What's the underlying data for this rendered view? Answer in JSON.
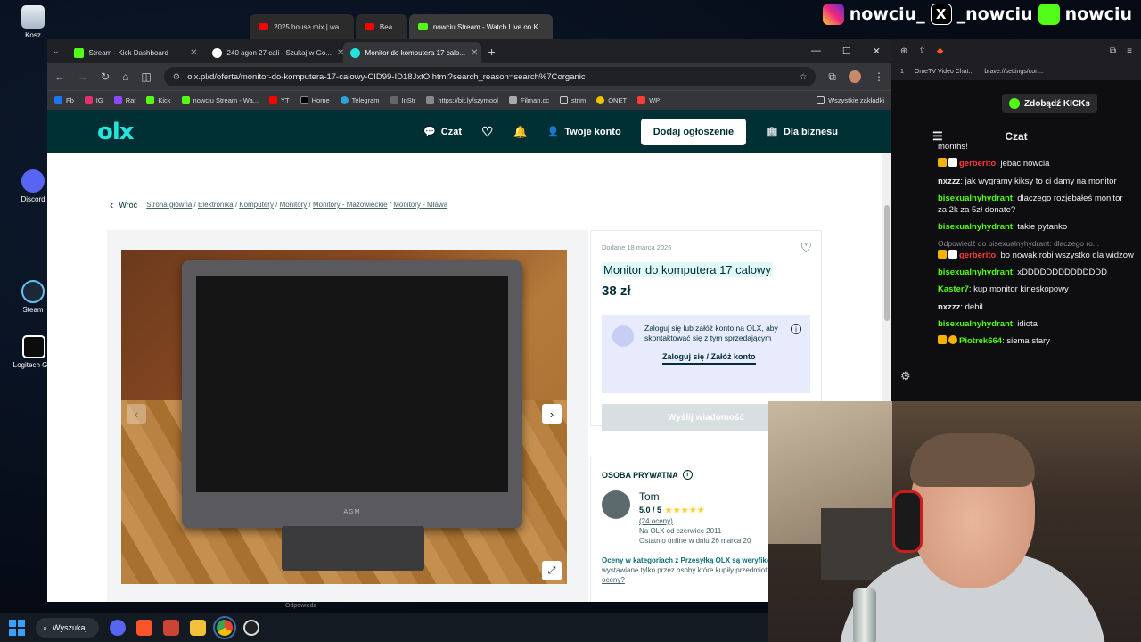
{
  "desktop": {
    "icons": [
      {
        "label": "Kosz"
      },
      {
        "label": "Discord"
      },
      {
        "label": "Steam"
      },
      {
        "label": "Logitech G H"
      }
    ]
  },
  "back_tabs": [
    {
      "label": "2025 house mix | wa..."
    },
    {
      "label": "Bea..."
    },
    {
      "label": "nowciu Stream - Watch Live on K..."
    }
  ],
  "socials": {
    "instagram": "nowciu_",
    "x": "_nowciu",
    "kick": "nowciu"
  },
  "browser": {
    "tabs": [
      {
        "label": "Stream - Kick Dashboard"
      },
      {
        "label": "240 agon 27 cali - Szukaj w Go..."
      },
      {
        "label": "Monitor do komputera 17 calo..."
      }
    ],
    "url": "olx.pl/d/oferta/monitor-do-komputera-17-calowy-CID99-ID18JxtO.html?search_reason=search%7Corganic",
    "bookmarks": [
      "Fb",
      "IG",
      "Rat",
      "Kick",
      "nowciu Stream - Wa...",
      "YT",
      "Home",
      "Telegram",
      "InStr",
      "https://bit.ly/szymool",
      "Filman.cc",
      "strim",
      "ONET",
      "WP",
      "Wszystkie zakładki"
    ]
  },
  "olx": {
    "nav": {
      "chat": "Czat",
      "account": "Twoje konto",
      "add": "Dodaj ogłoszenie",
      "business": "Dla biznesu"
    },
    "back": "Wróć",
    "breadcrumbs": [
      "Strona główna",
      "Elektronika",
      "Komputery",
      "Monitory",
      "Monitory - Mazowieckie",
      "Monitory - Mława"
    ],
    "photo_brand": "AGM",
    "listing": {
      "posted": "Dodane 18 marca 2026",
      "title": "Monitor do komputera 17 calowy",
      "price": "38 zł",
      "login_prompt": "Zaloguj się lub załóż konto na OLX, aby skontaktować się z tym sprzedającym",
      "login_link": "Zaloguj się / Załóż konto",
      "send": "Wyślij wiadomość"
    },
    "seller": {
      "header": "OSOBA PRYWATNA",
      "name": "Tom",
      "rating": "5.0 / 5",
      "stars": "★★★★★",
      "reviews": "(24 oceny)",
      "since": "Na OLX od czerwiec 2011",
      "online": "Ostatnio online w dniu 26 marca 20",
      "note_bold": "Oceny w kategoriach z Przesyłką OLX są weryfikowane",
      "note_rest": " i wystawiane tylko przez osoby które kupiły przedmiot.",
      "note_link": "Jak działają oceny?"
    }
  },
  "chat": {
    "bookmark_labels": [
      "1",
      "OmeTV Video Chat...",
      "brave://settings/con..."
    ],
    "kicks_button": "Zdobądź KICKs",
    "title": "Czat",
    "partial": "months!",
    "messages": [
      {
        "user": "gerberito",
        "text": ": jebac nowcia",
        "color": "#ff3b3b"
      },
      {
        "user": "nxzzz",
        "text": ": jak wygramy kiksy to ci damy na monitor",
        "color": "#e6e6e6"
      },
      {
        "user": "bisexualnyhydrant",
        "text": ": dlaczego rozjebałeś monitor za 2k za 5zł donate?",
        "color": "#53fc18"
      },
      {
        "user": "bisexualnyhydrant",
        "text": ": takie pytanko",
        "color": "#53fc18"
      },
      {
        "reply": "Odpowiedź do bisexualnyhydrant: dlaczego ro...",
        "user": "gerberito",
        "text": ": bo nowak robi wszystko dla widzow",
        "color": "#ff3b3b"
      },
      {
        "user": "bisexualnyhydrant",
        "text": ": xDDDDDDDDDDDDDD",
        "color": "#53fc18"
      },
      {
        "user": "Kaster7",
        "text": ": kup monitor kineskopowy",
        "color": "#53fc18"
      },
      {
        "user": "nxzzz",
        "text": ": debil",
        "color": "#e6e6e6"
      },
      {
        "user": "bisexualnyhydrant",
        "text": ": idiota",
        "color": "#53fc18"
      },
      {
        "user": "Piotrek664",
        "text": ": siema stary",
        "color": "#53fc18"
      }
    ]
  },
  "taskbar": {
    "search": "Wyszukaj"
  },
  "chat_peek": "Odpowiedz"
}
